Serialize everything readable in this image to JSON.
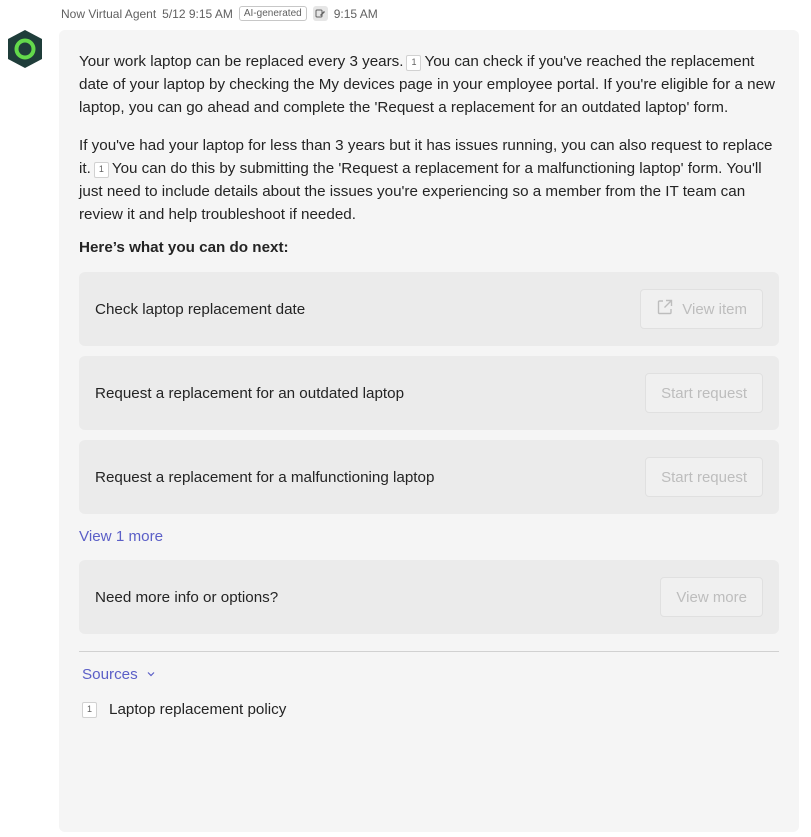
{
  "header": {
    "sender": "Now Virtual Agent",
    "timestamp": "5/12 9:15 AM",
    "ai_badge": "AI-generated",
    "edit_time": "9:15 AM"
  },
  "message": {
    "p1_a": "Your work laptop can be replaced every 3 years.",
    "p1_cite": "1",
    "p1_b": "You can check if you've reached the replacement date of your laptop by checking the My devices page in your employee portal. If you're eligible for a new laptop, you can go ahead and complete the 'Request a replacement for an outdated laptop' form.",
    "p2_a": "If you've had your laptop for less than 3 years but it has issues running, you can also request to replace it.",
    "p2_cite": "1",
    "p2_b": "You can do this by submitting the 'Request a replacement for a malfunctioning laptop' form. You'll just need to include details about the issues you're experiencing so a member from the IT team can review it and help troubleshoot if needed."
  },
  "next": {
    "title": "Here’s what you can do next:",
    "actions": [
      {
        "label": "Check laptop replacement date",
        "button": "View item"
      },
      {
        "label": "Request a replacement for an outdated laptop",
        "button": "Start request"
      },
      {
        "label": "Request a replacement for a malfunctioning laptop",
        "button": "Start request"
      }
    ],
    "view_more_link": "View 1 more",
    "more_card": {
      "label": "Need more info or options?",
      "button": "View more"
    }
  },
  "sources": {
    "toggle": "Sources",
    "items": [
      {
        "num": "1",
        "title": "Laptop replacement policy"
      }
    ]
  },
  "colors": {
    "accent": "#5b5fc7",
    "avatar_fill": "#1f3d3a",
    "avatar_ring": "#63d94b",
    "bubble": "#f5f5f5",
    "card": "#ebebeb"
  }
}
